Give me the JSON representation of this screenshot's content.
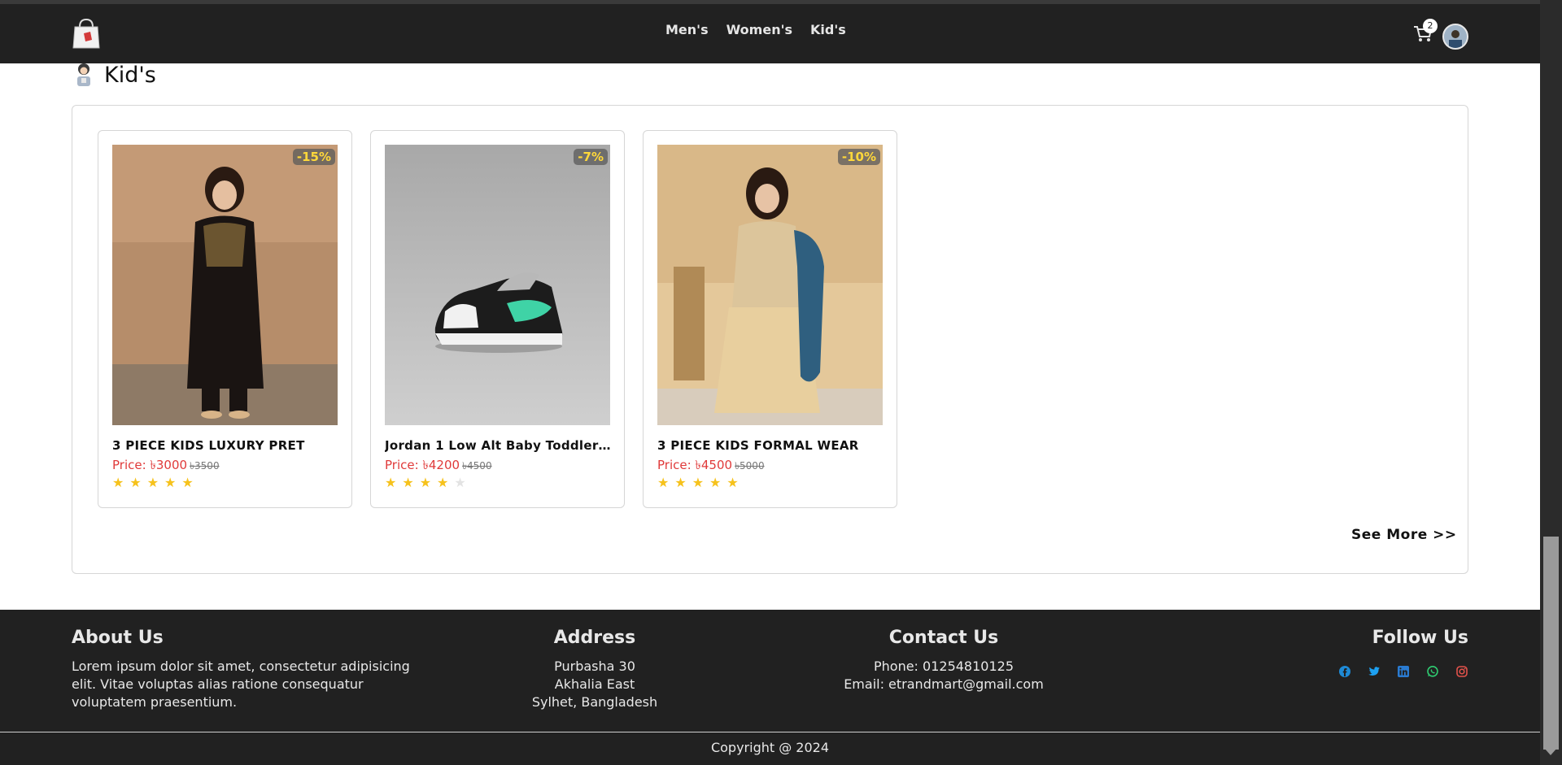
{
  "nav": {
    "links": [
      "Men's",
      "Women's",
      "Kid's"
    ],
    "cart_count": "2"
  },
  "section": {
    "title": "Kid's"
  },
  "products": [
    {
      "name": "3 PIECE KIDS LUXURY PRET",
      "discount": "-15%",
      "price": "Price: ৳3000",
      "old_price": "৳3500",
      "rating": 5
    },
    {
      "name": "Jordan 1 Low Alt Baby Toddler ...",
      "discount": "-7%",
      "price": "Price: ৳4200",
      "old_price": "৳4500",
      "rating": 4
    },
    {
      "name": "3 PIECE KIDS FORMAL WEAR",
      "discount": "-10%",
      "price": "Price: ৳4500",
      "old_price": "৳5000",
      "rating": 5
    }
  ],
  "see_more": "See More >>",
  "footer": {
    "about_title": "About Us",
    "about_text": "Lorem ipsum dolor sit amet, consectetur adipisicing elit. Vitae voluptas alias ratione consequatur voluptatem praesentium.",
    "address_title": "Address",
    "address_lines": [
      "Purbasha 30",
      "Akhalia East",
      "Sylhet, Bangladesh"
    ],
    "contact_title": "Contact Us",
    "phone": "Phone: 01254810125",
    "email": "Email: etrandmart@gmail.com",
    "follow_title": "Follow Us",
    "social": [
      {
        "icon": "facebook-icon",
        "color": "#1e8ad6"
      },
      {
        "icon": "twitter-icon",
        "color": "#1da1f2"
      },
      {
        "icon": "linkedin-icon",
        "color": "#2a7bd1"
      },
      {
        "icon": "whatsapp-icon",
        "color": "#2ecc71"
      },
      {
        "icon": "instagram-icon",
        "color": "#e2524b"
      }
    ]
  },
  "copyright": "Copyright @ 2024"
}
